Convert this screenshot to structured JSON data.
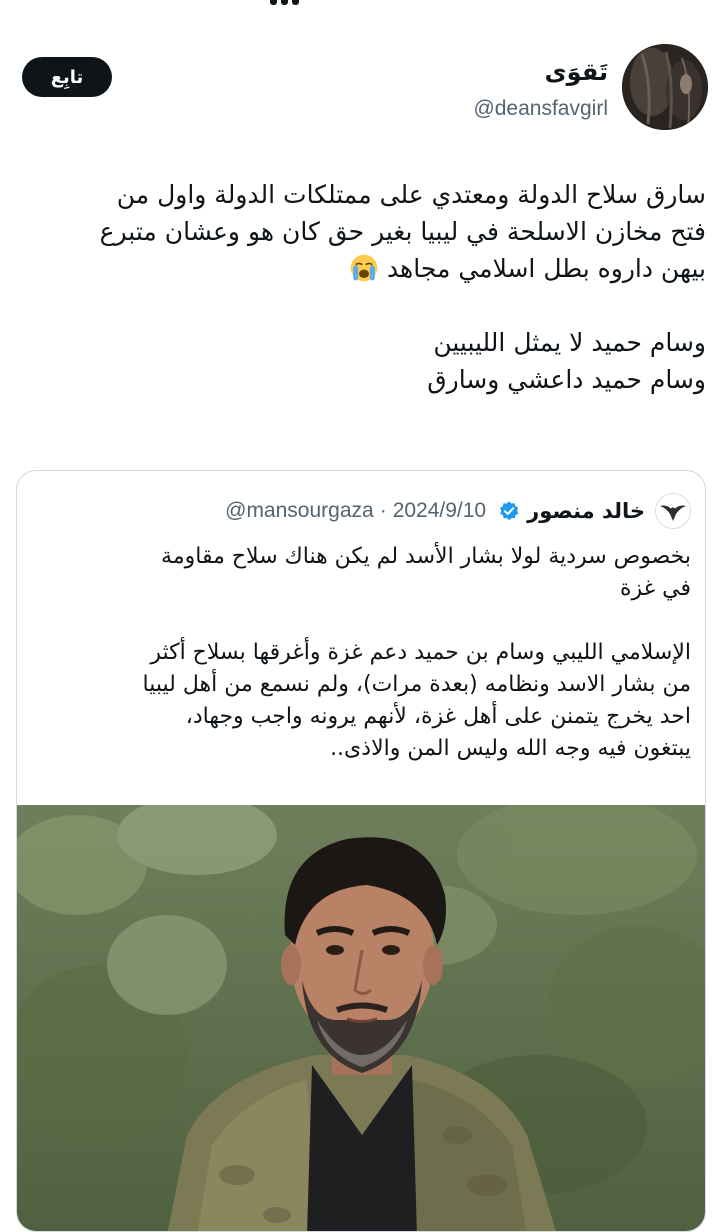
{
  "tweet": {
    "author": {
      "display_name": "تَقوَى",
      "handle": "@deansfavgirl"
    },
    "follow_label": "تابِع",
    "text_lines": [
      "سارق سلاح الدولة ومعتدي على ممتلكات الدولة واول من",
      "فتح مخازن الاسلحة في ليبيا بغير حق كان هو وعشان متبرع",
      "بيهن داروه بطل اسلامي مجاهد",
      "",
      "وسام حميد لا يمثل الليبيين",
      "وسام حميد داعشي وسارق"
    ],
    "emoji": "loudly-crying-face-icon"
  },
  "quoted_tweet": {
    "author": {
      "display_name": "خالد منصور",
      "handle": "@mansourgaza",
      "verified": true
    },
    "separator": "·",
    "date": "2024/9/10",
    "text_lines": [
      "بخصوص سردية لولا بشار الأسد لم يكن هناك سلاح مقاومة",
      "في غزة",
      "",
      "الإسلامي الليبي وسام بن حميد دعم غزة وأغرقها بسلاح أكثر",
      "من بشار الاسد ونظامه (بعدة مرات)، ولم نسمع من أهل ليبيا",
      "احد يخرج يتمنن على أهل غزة، لأنهم يرونه واجب وجهاد،",
      "يبتغون فيه وجه الله وليس المن والاذى.."
    ],
    "photo": "portrait-photo"
  },
  "colors": {
    "text": "#0f1419",
    "secondary": "#536471",
    "verified": "#1d9bf0",
    "border": "#cfd9de",
    "button_bg": "#0f1419"
  }
}
